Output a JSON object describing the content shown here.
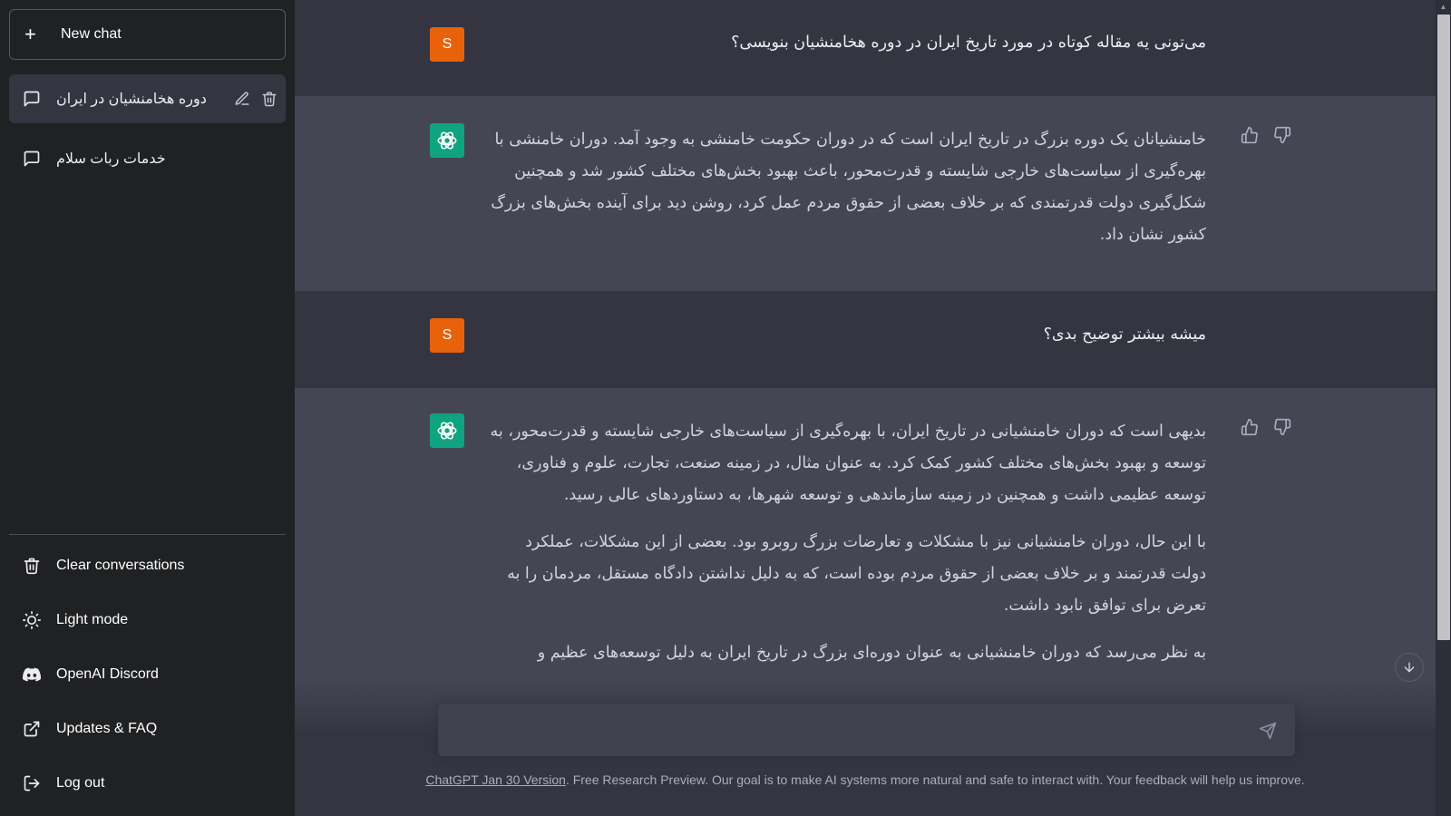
{
  "sidebar": {
    "new_chat_label": "New chat",
    "conversations": [
      {
        "title": "دوره هخامنشیان در ایران",
        "active": true
      },
      {
        "title": "خدمات ربات سلام",
        "active": false
      }
    ],
    "menu": [
      {
        "label": "Clear conversations",
        "icon": "trash-icon"
      },
      {
        "label": "Light mode",
        "icon": "sun-icon"
      },
      {
        "label": "OpenAI Discord",
        "icon": "discord-icon"
      },
      {
        "label": "Updates & FAQ",
        "icon": "external-link-icon"
      },
      {
        "label": "Log out",
        "icon": "logout-icon"
      }
    ]
  },
  "thread": {
    "user_avatar_letter": "S",
    "messages": [
      {
        "role": "user",
        "text": "می‌تونی یه مقاله کوتاه در مورد تاریخ ایران در دوره هخامنشیان بنویسی؟"
      },
      {
        "role": "assistant",
        "paragraphs": [
          "خامنشیانان یک دوره بزرگ در تاریخ ایران است که در دوران حکومت خامنشی به وجود آمد. دوران خامنشی با بهره‌گیری از سیاست‌های خارجی شایسته و قدرت‌محور، باعث بهبود بخش‌های مختلف کشور شد و همچنین شکل‌گیری دولت قدرتمندی که بر خلاف بعضی از حقوق مردم عمل کرد، روشن دید برای آینده بخش‌های بزرگ کشور نشان داد."
        ]
      },
      {
        "role": "user",
        "text": "میشه بیشتر توضیح بدی؟"
      },
      {
        "role": "assistant",
        "paragraphs": [
          "بدیهی است که دوران خامنشیانی در تاریخ ایران، با بهره‌گیری از سیاست‌های خارجی شایسته و قدرت‌محور، به توسعه و بهبود بخش‌های مختلف کشور کمک کرد. به عنوان مثال، در زمینه صنعت، تجارت، علوم و فناوری، توسعه عظیمی داشت و همچنین در زمینه سازماندهی و توسعه شهرها، به دستاوردهای عالی رسید.",
          "با این حال، دوران خامنشیانی نیز با مشکلات و تعارضات بزرگ روبرو بود. بعضی از این مشکلات، عملکرد دولت قدرتمند و بر خلاف بعضی از حقوق مردم بوده است، که به دلیل نداشتن دادگاه مستقل، مردمان را به تعرض برای توافق نابود داشت.",
          "به نظر می‌رسد که دوران خامنشیانی به عنوان دوره‌ای بزرگ در تاریخ ایران به دلیل توسعه‌های عظیم و"
        ]
      }
    ]
  },
  "composer": {
    "placeholder": ""
  },
  "footer": {
    "version_link": "ChatGPT Jan 30 Version",
    "text": ". Free Research Preview. Our goal is to make AI systems more natural and safe to interact with. Your feedback will help us improve."
  },
  "colors": {
    "sidebar_bg": "#202123",
    "main_bg": "#343541",
    "assistant_row_bg": "#444654",
    "user_avatar": "#e8620c",
    "assistant_avatar": "#10a37f"
  }
}
